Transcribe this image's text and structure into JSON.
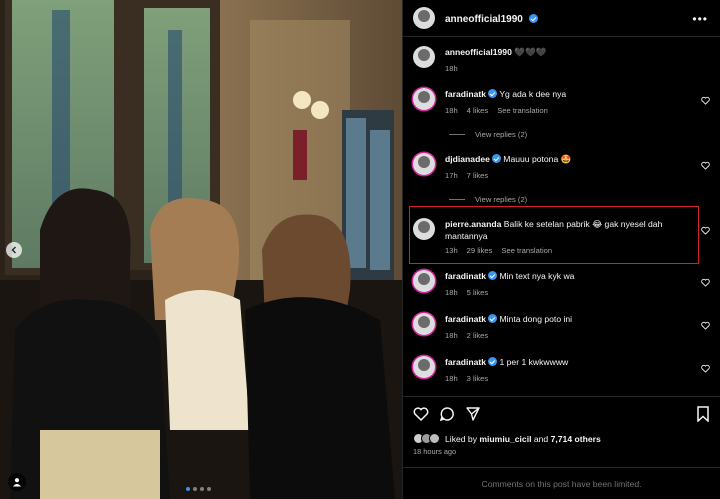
{
  "post": {
    "author": "anneofficial1990",
    "caption_author": "anneofficial1990",
    "caption_text": "🖤🖤🖤",
    "caption_time": "18h",
    "photo_dots": 4,
    "photo_active_dot": 1
  },
  "comments": [
    {
      "user": "faradinatk",
      "verified": true,
      "text": "Yg ada k dee nya",
      "time": "18h",
      "likes": "4 likes",
      "translate": "See translation",
      "replies": "View replies (2)"
    },
    {
      "user": "djdianadee",
      "verified": true,
      "text": "Mauuu potona 🤩",
      "time": "17h",
      "likes": "7 likes",
      "translate": "",
      "replies": "View replies (2)"
    },
    {
      "user": "pierre.ananda",
      "verified": false,
      "text": "Balik ke setelan pabrik 😂 gak nyesel dah mantannya",
      "time": "13h",
      "likes": "29 likes",
      "translate": "See translation",
      "replies": ""
    },
    {
      "user": "faradinatk",
      "verified": true,
      "text": "Min text nya kyk wa",
      "time": "18h",
      "likes": "5 likes",
      "translate": "",
      "replies": ""
    },
    {
      "user": "faradinatk",
      "verified": true,
      "text": "Minta dong poto ini",
      "time": "18h",
      "likes": "2 likes",
      "translate": "",
      "replies": ""
    },
    {
      "user": "faradinatk",
      "verified": true,
      "text": "1 per 1 kwkwwww",
      "time": "18h",
      "likes": "3 likes",
      "translate": "",
      "replies": ""
    }
  ],
  "likes": {
    "prefix": "Liked by",
    "by_user": "miumiu_cicil",
    "and": "and",
    "others": "7,714 others"
  },
  "post_time": "18 hours ago",
  "comments_limited": "Comments on this post have been limited.",
  "colors": {
    "highlight_border": "#d4241f",
    "verified": "#3897f0",
    "story_ring": "#d6249f"
  },
  "icons": [
    "more-icon",
    "heart-icon",
    "comment-icon",
    "share-icon",
    "bookmark-icon",
    "verified-icon",
    "tag-user-icon",
    "chevron-left-icon"
  ]
}
